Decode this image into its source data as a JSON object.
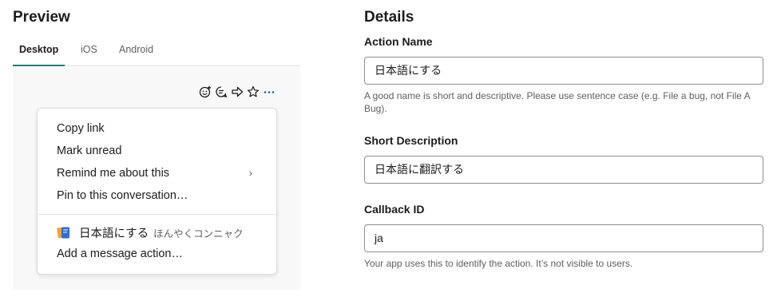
{
  "preview": {
    "title": "Preview",
    "tabs": [
      {
        "label": "Desktop",
        "active": true
      },
      {
        "label": "iOS",
        "active": false
      },
      {
        "label": "Android",
        "active": false
      }
    ],
    "message_actions": [
      "add-reaction-icon",
      "reply-in-thread-icon",
      "share-icon",
      "star-icon",
      "more-icon"
    ],
    "menu": {
      "items": [
        {
          "label": "Copy link"
        },
        {
          "label": "Mark unread"
        },
        {
          "label": "Remind me about this",
          "chevron": "›"
        },
        {
          "label": "Pin to this conversation…"
        }
      ],
      "app_action": {
        "icon": "app-icon",
        "label": "日本語にする",
        "sublabel": "ほんやくコンニャク"
      },
      "add_action_label": "Add a message action…"
    }
  },
  "details": {
    "title": "Details",
    "action_name": {
      "label": "Action Name",
      "value": "日本語にする",
      "hint": "A good name is short and descriptive. Please use sentence case (e.g. File a bug, not File A Bug)."
    },
    "short_description": {
      "label": "Short Description",
      "value": "日本語に翻訳する"
    },
    "callback_id": {
      "label": "Callback ID",
      "value": "ja",
      "hint": "Your app uses this to identify the action. It’s not visible to users."
    }
  },
  "colors": {
    "accent_tab": "#1c7e6e",
    "more_icon": "#1264a3",
    "preview_bg": "#f8f8f8"
  }
}
